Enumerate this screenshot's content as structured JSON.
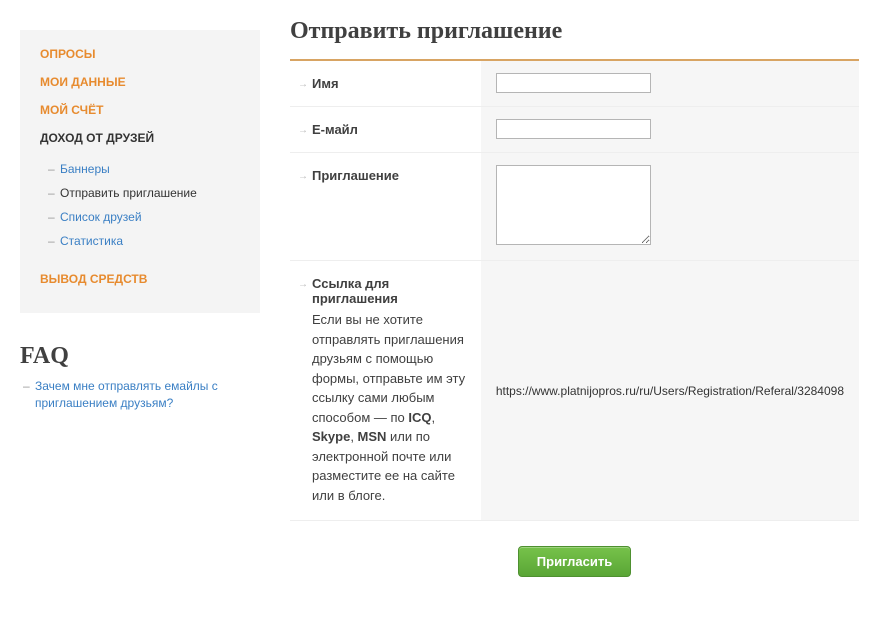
{
  "sidebar": {
    "main_items": [
      {
        "label": "ОПРОСЫ",
        "cls": "orange"
      },
      {
        "label": "МОИ ДАННЫЕ",
        "cls": "orange"
      },
      {
        "label": "МОЙ СЧЁТ",
        "cls": "orange"
      },
      {
        "label": "ДОХОД ОТ ДРУЗЕЙ",
        "cls": "black"
      }
    ],
    "sub_items": [
      {
        "label": "Баннеры",
        "cls": "blue"
      },
      {
        "label": "Отправить приглашение",
        "cls": "dark"
      },
      {
        "label": "Список друзей",
        "cls": "blue"
      },
      {
        "label": "Статистика",
        "cls": "blue"
      }
    ],
    "footer_item": {
      "label": "ВЫВОД СРЕДСТВ",
      "cls": "orange"
    }
  },
  "faq": {
    "title": "FAQ",
    "items": [
      "Зачем мне отправлять емайлы с приглашением друзьям?"
    ]
  },
  "page": {
    "title": "Отправить приглашение"
  },
  "form": {
    "name_label": "Имя",
    "email_label": "Е-майл",
    "invitation_label": "Приглашение",
    "link_label": "Ссылка для приглашения",
    "link_desc_1": "Если вы не хотите отправлять приглашения друзьям с помощью формы, отправьте им эту ссылку сами любым способом — по ",
    "link_desc_bold1": "ICQ",
    "link_desc_sep1": ", ",
    "link_desc_bold2": "Skype",
    "link_desc_sep2": ", ",
    "link_desc_bold3": "MSN",
    "link_desc_2": " или по электронной почте или разместите ее на сайте или в блоге.",
    "referral_link": "https://www.platnijopros.ru/ru/Users/Registration/Referal/3284098",
    "submit_label": "Пригласить"
  }
}
